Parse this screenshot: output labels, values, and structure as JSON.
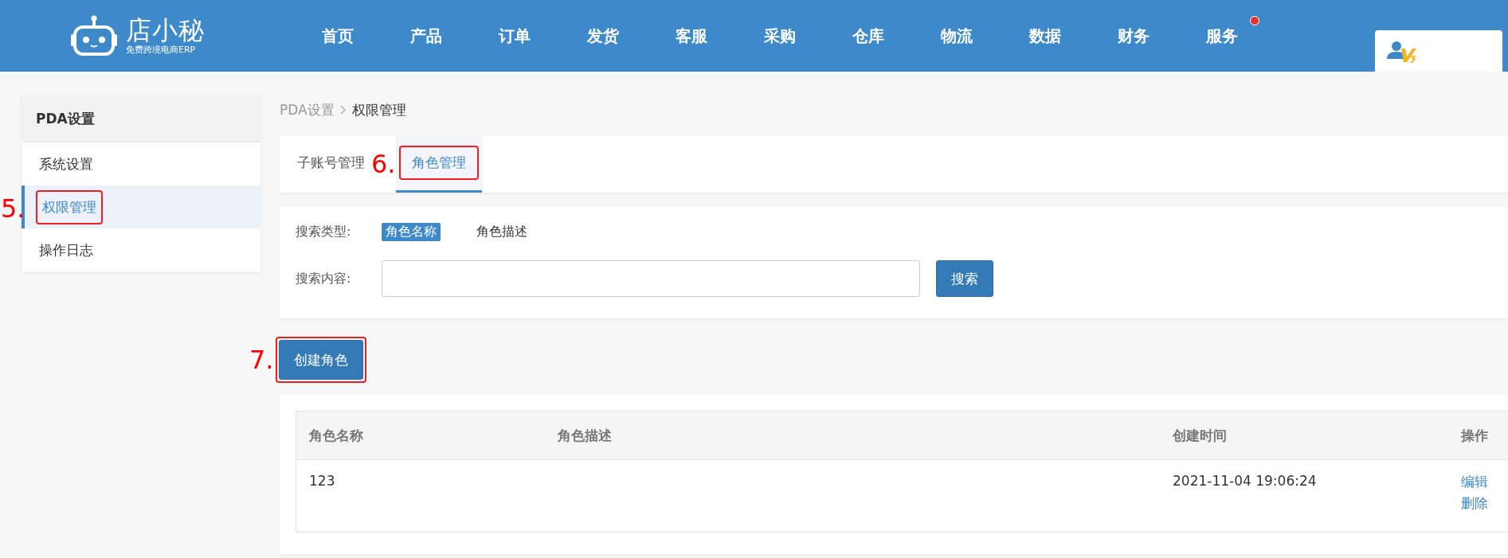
{
  "header": {
    "logo": {
      "name": "店小秘",
      "tagline": "免费跨境电商ERP"
    },
    "nav": [
      {
        "label": "首页",
        "badge": false
      },
      {
        "label": "产品",
        "badge": false
      },
      {
        "label": "订单",
        "badge": false
      },
      {
        "label": "发货",
        "badge": false
      },
      {
        "label": "客服",
        "badge": false
      },
      {
        "label": "采购",
        "badge": false
      },
      {
        "label": "仓库",
        "badge": false
      },
      {
        "label": "物流",
        "badge": false
      },
      {
        "label": "数据",
        "badge": false
      },
      {
        "label": "财务",
        "badge": false
      },
      {
        "label": "服务",
        "badge": true
      }
    ]
  },
  "sidebar": {
    "title": "PDA设置",
    "items": [
      {
        "label": "系统设置",
        "selected": false
      },
      {
        "label": "权限管理",
        "selected": true,
        "annotation": "5."
      },
      {
        "label": "操作日志",
        "selected": false
      }
    ]
  },
  "breadcrumb": [
    "PDA设置",
    "权限管理"
  ],
  "tabs": [
    {
      "label": "子账号管理",
      "selected": false
    },
    {
      "label": "角色管理",
      "selected": true,
      "annotation": "6."
    }
  ],
  "search": {
    "type_label": "搜索类型:",
    "types": [
      {
        "label": "角色名称",
        "selected": true
      },
      {
        "label": "角色描述",
        "selected": false
      }
    ],
    "content_label": "搜索内容:",
    "button": "搜索"
  },
  "create_button": {
    "label": "创建角色",
    "annotation": "7."
  },
  "table": {
    "columns": [
      "角色名称",
      "角色描述",
      "创建时间",
      "操作"
    ],
    "rows": [
      {
        "name": "123",
        "created": "2021-11-04 19:06:24",
        "actions": [
          "编辑",
          "删除"
        ]
      }
    ]
  }
}
